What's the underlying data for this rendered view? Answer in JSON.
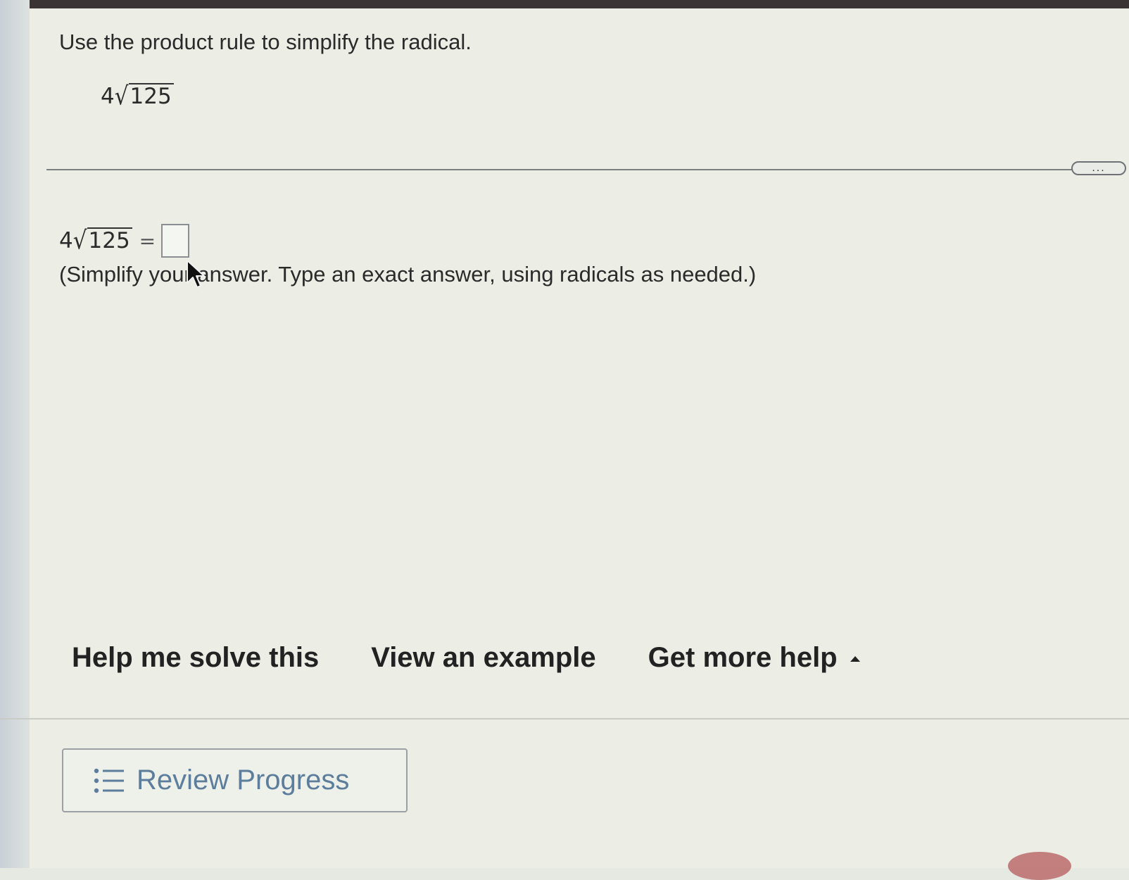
{
  "question": {
    "prompt": "Use the product rule to simplify the radical.",
    "coefficient": "4",
    "radicand": "125"
  },
  "toolbar": {
    "more_label": "..."
  },
  "answer": {
    "coefficient": "4",
    "radicand": "125",
    "equals": "=",
    "value": "",
    "instruction": "(Simplify your answer. Type an exact answer, using radicals as needed.)"
  },
  "help": {
    "help_me_solve": "Help me solve this",
    "view_example": "View an example",
    "get_more_help": "Get more help"
  },
  "footer": {
    "review_progress": "Review Progress"
  },
  "icons": {
    "radical": "square-root-icon",
    "caret": "caret-up-icon",
    "list": "list-icon",
    "cursor": "mouse-cursor-icon"
  },
  "colors": {
    "link_blue": "#5c7d9c",
    "top_bar": "#3a3434"
  }
}
